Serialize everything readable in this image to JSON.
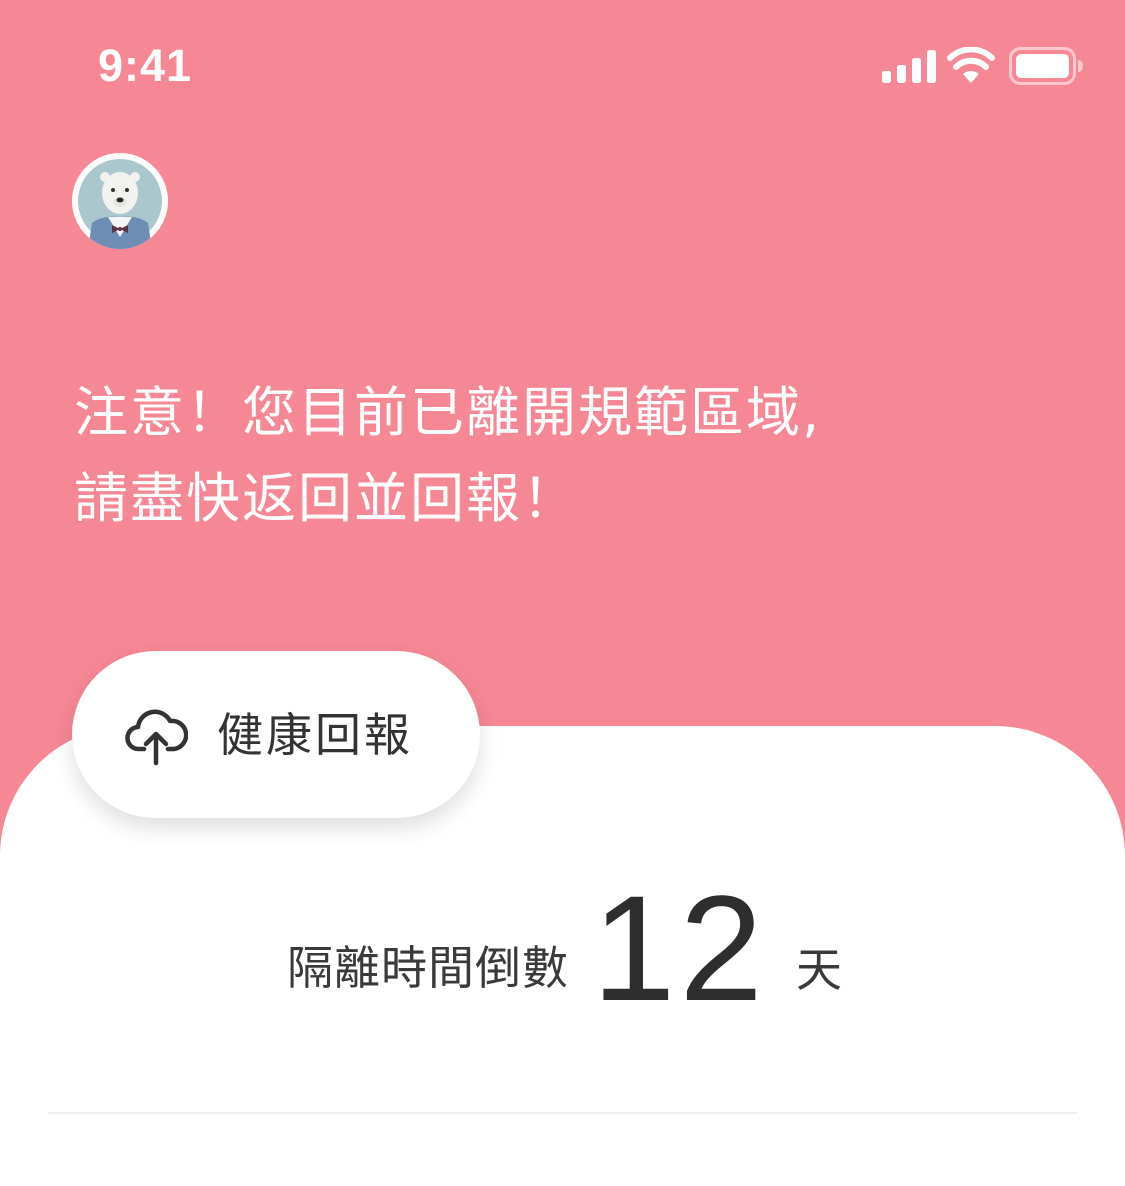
{
  "status_bar": {
    "time": "9:41",
    "icons": [
      "signal-icon",
      "wifi-icon",
      "battery-icon"
    ]
  },
  "profile": {
    "avatar_icon": "polar-bear-avatar"
  },
  "alert": {
    "line1": "注意！您目前已離開規範區域,",
    "line2": "請盡快返回並回報！"
  },
  "report_button": {
    "icon": "cloud-upload-icon",
    "label": "健康回報"
  },
  "countdown": {
    "label": "隔離時間倒數",
    "value": "12",
    "unit": "天"
  },
  "colors": {
    "header_background": "#F68795",
    "sheet_background": "#FFFFFF",
    "text_dark": "#333333",
    "text_light": "#FFFFFF"
  }
}
